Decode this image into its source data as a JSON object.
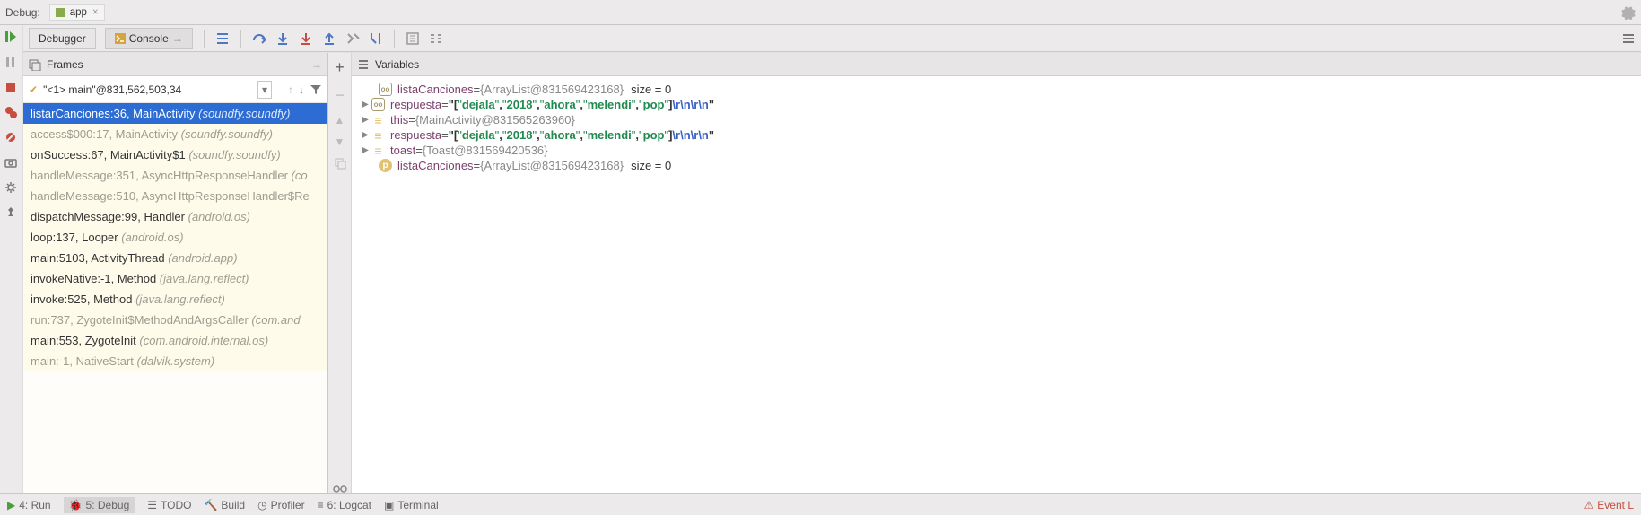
{
  "top": {
    "debugLabel": "Debug:",
    "tabLabel": "app",
    "closeGlyph": "×"
  },
  "toolbar": {
    "tab1": "Debugger",
    "tab2": "Console"
  },
  "frames": {
    "header": "Frames",
    "thread": "\"<1> main\"@831,562,503,34",
    "items": [
      {
        "text": "listarCanciones:36, MainActivity ",
        "pkg": "(soundfy.soundfy)",
        "selected": true
      },
      {
        "text": "access$000:17, MainActivity ",
        "pkg": "(soundfy.soundfy)",
        "dim": true
      },
      {
        "text": "onSuccess:67, MainActivity$1 ",
        "pkg": "(soundfy.soundfy)"
      },
      {
        "text": "handleMessage:351, AsyncHttpResponseHandler ",
        "pkg": "(co",
        "dim": true
      },
      {
        "text": "handleMessage:510, AsyncHttpResponseHandler$Re",
        "pkg": "",
        "dim": true
      },
      {
        "text": "dispatchMessage:99, Handler ",
        "pkg": "(android.os)"
      },
      {
        "text": "loop:137, Looper ",
        "pkg": "(android.os)"
      },
      {
        "text": "main:5103, ActivityThread ",
        "pkg": "(android.app)"
      },
      {
        "text": "invokeNative:-1, Method ",
        "pkg": "(java.lang.reflect)"
      },
      {
        "text": "invoke:525, Method ",
        "pkg": "(java.lang.reflect)"
      },
      {
        "text": "run:737, ZygoteInit$MethodAndArgsCaller ",
        "pkg": "(com.and",
        "dim": true
      },
      {
        "text": "main:553, ZygoteInit ",
        "pkg": "(com.android.internal.os)"
      },
      {
        "text": "main:-1, NativeStart ",
        "pkg": "(dalvik.system)",
        "dim": true
      }
    ]
  },
  "variables": {
    "header": "Variables",
    "v1": {
      "name": "listaCanciones",
      "eq": " = ",
      "obj": "{ArrayList@831569423168}",
      "size": "size = 0"
    },
    "v2name": "respuesta",
    "v2eq": " = ",
    "json_open": "\"[",
    "json_q": "\"",
    "json_c": ",",
    "json_close": "]",
    "json_esc": "\\r\\n\\r\\n",
    "dejala": "dejala",
    "y2018": "2018",
    "ahora": "ahora",
    "melendi": "melendi",
    "pop": "pop",
    "v3": {
      "name": "this",
      "eq": " = ",
      "obj": "{MainActivity@831565263960}"
    },
    "v5": {
      "name": "toast",
      "eq": " = ",
      "obj": "{Toast@831569420536}"
    },
    "v6": {
      "name": "listaCanciones",
      "eq": " = ",
      "obj": "{ArrayList@831569423168}",
      "size": "size = 0"
    }
  },
  "bottom": {
    "run": "4: Run",
    "debug": "5: Debug",
    "todo": "TODO",
    "build": "Build",
    "profiler": "Profiler",
    "logcat": "6: Logcat",
    "terminal": "Terminal",
    "event": "Event L"
  }
}
